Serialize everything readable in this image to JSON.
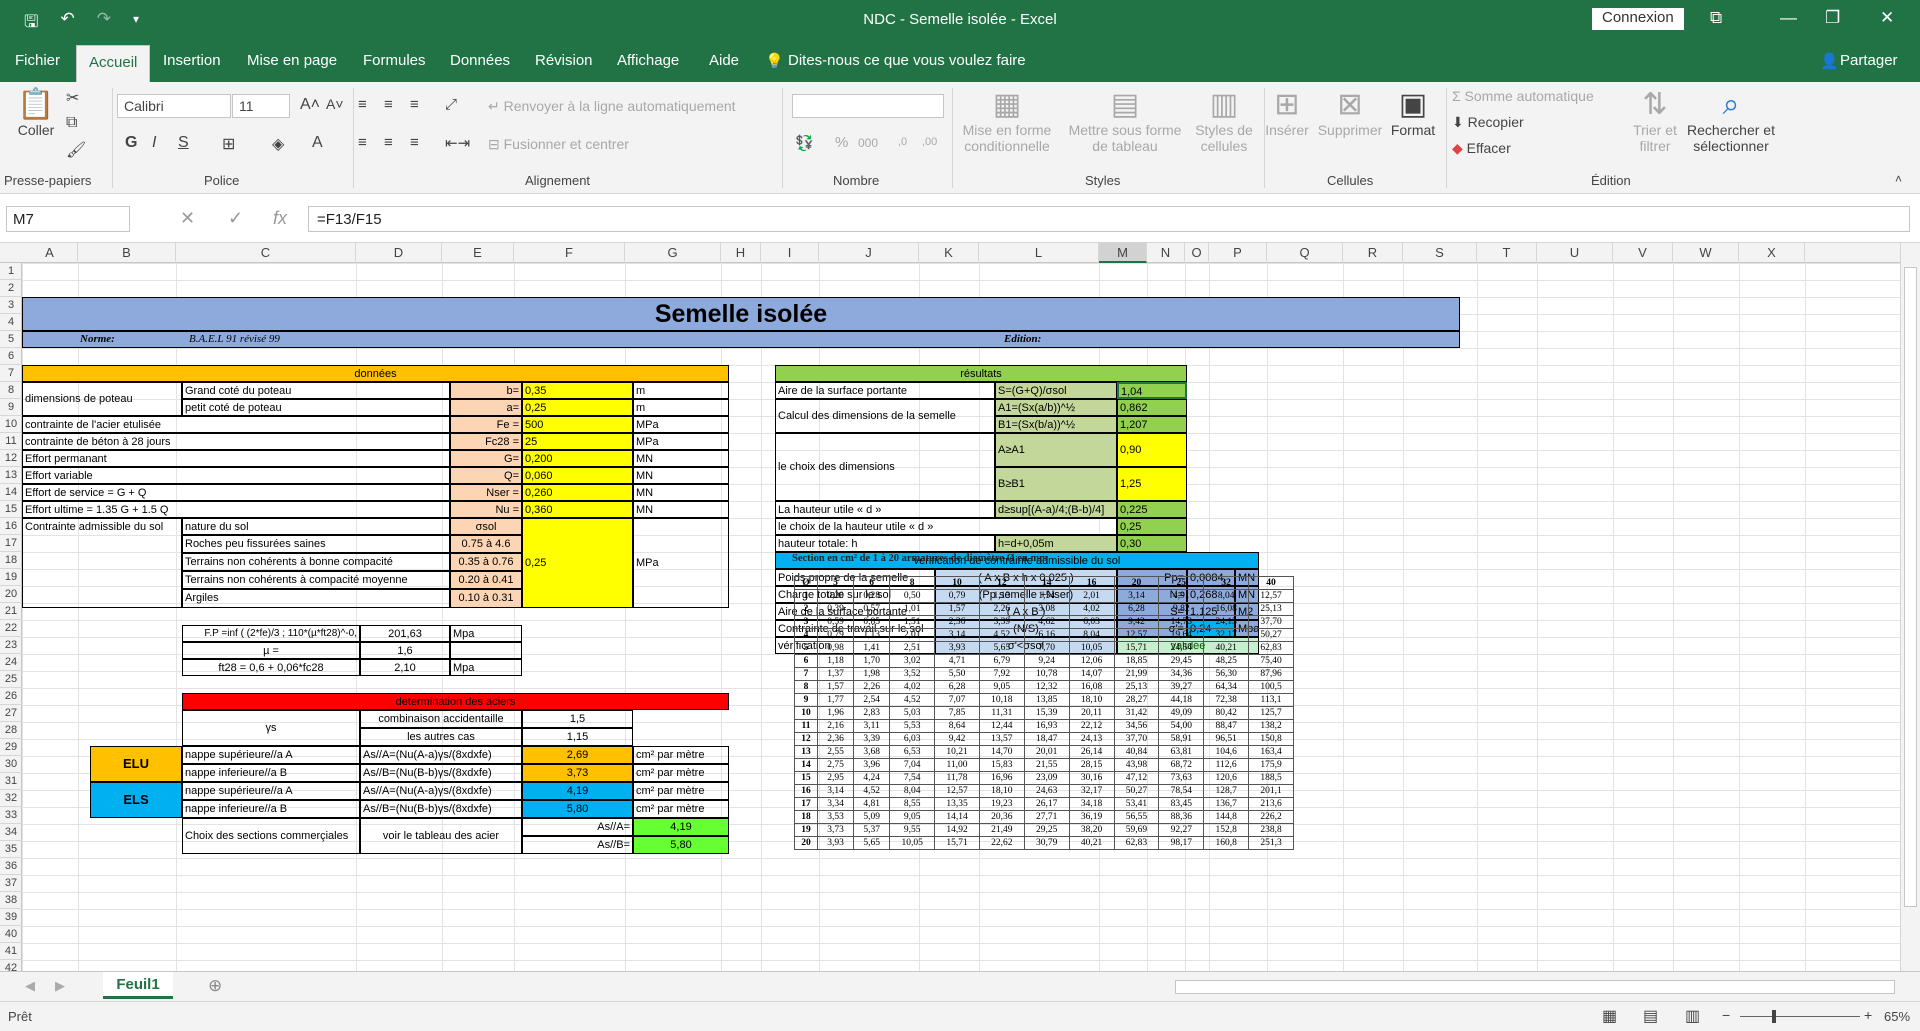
{
  "window": {
    "title": "NDC - Semelle isolée  -  Excel",
    "signin": "Connexion"
  },
  "menu": {
    "tabs": [
      "Fichier",
      "Accueil",
      "Insertion",
      "Mise en page",
      "Formules",
      "Données",
      "Révision",
      "Affichage",
      "Aide"
    ],
    "tell": "Dites-nous ce que vous voulez faire",
    "share": "Partager"
  },
  "ribbon": {
    "coller": "Coller",
    "font_name": "Calibri",
    "font_size": "11",
    "wrap": "Renvoyer à la ligne automatiquement",
    "merge": "Fusionner et centrer",
    "mfc1": "Mise en forme",
    "mfc2": "conditionnelle",
    "mst1": "Mettre sous forme",
    "mst2": "de tableau",
    "sty1": "Styles de",
    "sty2": "cellules",
    "ins": "Insérer",
    "sup": "Supprimer",
    "fmt": "Format",
    "autosum": "Somme automatique",
    "recopier": "Recopier",
    "effacer": "Effacer",
    "trier1": "Trier et",
    "trier2": "filtrer",
    "rech1": "Rechercher et",
    "rech2": "sélectionner",
    "groups": [
      "Presse-papiers",
      "Police",
      "Alignement",
      "Nombre",
      "Styles",
      "Cellules",
      "Édition"
    ]
  },
  "formula_bar": {
    "cell": "M7",
    "formula": "=F13/F15"
  },
  "columns": [
    "A",
    "B",
    "C",
    "D",
    "E",
    "F",
    "G",
    "H",
    "I",
    "J",
    "K",
    "L",
    "M",
    "N",
    "O",
    "P",
    "Q",
    "R",
    "S",
    "T",
    "U",
    "V",
    "W",
    "X"
  ],
  "sheet": {
    "title": "Semelle isolée",
    "norme_label": "Norme:",
    "norme_value": "B.A.E.L 91 révisé 99",
    "edition_label": "Edition:",
    "donnees": "données",
    "r7": [
      "dimensions de poteau",
      "Grand coté du poteau",
      "b=",
      "0,35",
      "m"
    ],
    "r8": [
      "petit coté de poteau",
      "a=",
      "0,25",
      "m"
    ],
    "r9": [
      "contrainte de l'acier etulisée",
      "Fe =",
      "500",
      "MPa"
    ],
    "r10": [
      "contrainte de béton à 28 jours",
      "Fc28 =",
      "25",
      "MPa"
    ],
    "r11": [
      "Effort permanant",
      "G=",
      "0,200",
      "MN"
    ],
    "r12": [
      "Effort variable",
      "Q=",
      "0,060",
      "MN"
    ],
    "r13": [
      "Effort de service =  G + Q",
      "Nser =",
      "0,260",
      "MN"
    ],
    "r14": [
      "Effort ultime =  1.35 G + 1.5 Q",
      "Nu =",
      "0,360",
      "MN"
    ],
    "r15": [
      "Contrainte admissible du sol",
      "nature du sol",
      "σsol"
    ],
    "soils": [
      [
        "Roches peu fissurées saines",
        "0.75 à 4.6"
      ],
      [
        "Terrains non cohérents à bonne compacité",
        "0.35 à 0.76"
      ],
      [
        "Terrains non cohérents à compacité moyenne",
        "0.20 à 0.41"
      ],
      [
        "Argiles",
        "0.10 à 0.31"
      ]
    ],
    "sol_value": "0,25",
    "sol_unit": "MPa",
    "r21": [
      "F.P =inf ( (2*fe)/3 ; 110*(µ*ft28)^-0,",
      "201,63",
      "Mpa"
    ],
    "r22": [
      "µ =",
      "1,6"
    ],
    "r23": [
      "ft28 = 0,6 + 0,06*fc28",
      "2,10",
      "Mpa"
    ],
    "determ": "determination des aciers",
    "gamma": "γs",
    "comb": "combinaison accidentaille",
    "comb_v": "1,5",
    "autres": "les autres cas",
    "autres_v": "1,15",
    "elu": "ELU",
    "els": "ELS",
    "r28": [
      "nappe supérieure//a A",
      "As//A=(Nu(A-a)γs/(8xdxfe)",
      "2,69",
      "cm² par mètre"
    ],
    "r29": [
      "nappe inferieure//a B",
      "As//B=(Nu(B-b)γs/(8xdxfe)",
      "3,73",
      "cm² par mètre"
    ],
    "r30": [
      "nappe supérieure//a A",
      "As//A=(Nu(A-a)γs/(8xdxfe)",
      "4,19",
      "cm² par mètre"
    ],
    "r31": [
      "nappe inferieure//a B",
      "As//B=(Nu(B-b)γs/(8xdxfe)",
      "5,80",
      "cm² par mètre"
    ],
    "choix": "Choix des sections commerçiales",
    "voir": "voir le tableau des acier",
    "asA": "As//A=",
    "asA_v": "4,19",
    "asB": "As//B=",
    "asB_v": "5,80",
    "resultats": "résultats",
    "res7": [
      "Aire de la surface portante",
      "S=(G+Q)/σsol",
      "1,04"
    ],
    "res8": [
      "Calcul des dimensions de la semelle",
      "A1=(Sx(a/b))^½",
      "0,862"
    ],
    "res9": [
      "B1=(Sx(b/a))^½",
      "1,207"
    ],
    "res10": [
      "le choix des dimensions",
      "A≥A1",
      "0,90"
    ],
    "res12": [
      "B≥B1",
      "1,25"
    ],
    "res14": [
      "La hauteur utile « d »",
      "d≥sup[(A-a)/4;(B-b)/4]",
      "0,225"
    ],
    "res15": [
      "le choix de la hauteur utile « d »",
      "0,25"
    ],
    "res16": [
      "hauteur totale: h",
      "h=d+0,05m",
      "0,30"
    ],
    "verif_title": "vérification de contrainte admissible du sol",
    "v18": [
      "Poids propre de la semelle",
      "( A x B x h x 0.025 )",
      "Pp=",
      "0,0084",
      "MN"
    ],
    "v19": [
      "Charge totale sur le sol",
      "(Pp semelle +Nser)",
      "N=",
      "0,268",
      "MN"
    ],
    "v20": [
      "Aire de la surface portante",
      "( A x B )",
      "S=",
      "1,125",
      "M2"
    ],
    "v21": [
      "Contrainte de travail sur le sol",
      "(N/S)",
      "σ'=",
      "0,24",
      "Mpa"
    ],
    "v22": [
      "vérification",
      "σ'<σsol",
      "validée"
    ],
    "steel_title": "Section en cm² de 1 à 20 armatures de diamètre Ø en mm",
    "steel_head": [
      "Ø",
      "5",
      "6",
      "8",
      "10",
      "12",
      "14",
      "16",
      "20",
      "25",
      "32",
      "40"
    ],
    "steel_rows": [
      [
        "1",
        "0,20",
        "0,28",
        "0,50",
        "0,79",
        "1,13",
        "1,54",
        "2,01",
        "3,14",
        "4,91",
        "8,04",
        "12,57"
      ],
      [
        "2",
        "0,39",
        "0,57",
        "1,01",
        "1,57",
        "2,26",
        "3,08",
        "4,02",
        "6,28",
        "9,82",
        "16,08",
        "25,13"
      ],
      [
        "3",
        "0,59",
        "0,85",
        "1,51",
        "2,36",
        "3,39",
        "4,62",
        "6,03",
        "9,42",
        "14,73",
        "24,13",
        "37,70"
      ],
      [
        "4",
        "0,79",
        "1,13",
        "2,01",
        "3,14",
        "4,52",
        "6,16",
        "8,04",
        "12,57",
        "19,64",
        "32,17",
        "50,27"
      ],
      [
        "5",
        "0,98",
        "1,41",
        "2,51",
        "3,93",
        "5,65",
        "7,70",
        "10,05",
        "15,71",
        "24,54",
        "40,21",
        "62,83"
      ],
      [
        "6",
        "1,18",
        "1,70",
        "3,02",
        "4,71",
        "6,79",
        "9,24",
        "12,06",
        "18,85",
        "29,45",
        "48,25",
        "75,40"
      ],
      [
        "7",
        "1,37",
        "1,98",
        "3,52",
        "5,50",
        "7,92",
        "10,78",
        "14,07",
        "21,99",
        "34,36",
        "56,30",
        "87,96"
      ],
      [
        "8",
        "1,57",
        "2,26",
        "4,02",
        "6,28",
        "9,05",
        "12,32",
        "16,08",
        "25,13",
        "39,27",
        "64,34",
        "100,5"
      ],
      [
        "9",
        "1,77",
        "2,54",
        "4,52",
        "7,07",
        "10,18",
        "13,85",
        "18,10",
        "28,27",
        "44,18",
        "72,38",
        "113,1"
      ],
      [
        "10",
        "1,96",
        "2,83",
        "5,03",
        "7,85",
        "11,31",
        "15,39",
        "20,11",
        "31,42",
        "49,09",
        "80,42",
        "125,7"
      ],
      [
        "11",
        "2,16",
        "3,11",
        "5,53",
        "8,64",
        "12,44",
        "16,93",
        "22,12",
        "34,56",
        "54,00",
        "88,47",
        "138,2"
      ],
      [
        "12",
        "2,36",
        "3,39",
        "6,03",
        "9,42",
        "13,57",
        "18,47",
        "24,13",
        "37,70",
        "58,91",
        "96,51",
        "150,8"
      ],
      [
        "13",
        "2,55",
        "3,68",
        "6,53",
        "10,21",
        "14,70",
        "20,01",
        "26,14",
        "40,84",
        "63,81",
        "104,6",
        "163,4"
      ],
      [
        "14",
        "2,75",
        "3,96",
        "7,04",
        "11,00",
        "15,83",
        "21,55",
        "28,15",
        "43,98",
        "68,72",
        "112,6",
        "175,9"
      ],
      [
        "15",
        "2,95",
        "4,24",
        "7,54",
        "11,78",
        "16,96",
        "23,09",
        "30,16",
        "47,12",
        "73,63",
        "120,6",
        "188,5"
      ],
      [
        "16",
        "3,14",
        "4,52",
        "8,04",
        "12,57",
        "18,10",
        "24,63",
        "32,17",
        "50,27",
        "78,54",
        "128,7",
        "201,1"
      ],
      [
        "17",
        "3,34",
        "4,81",
        "8,55",
        "13,35",
        "19,23",
        "26,17",
        "34,18",
        "53,41",
        "83,45",
        "136,7",
        "213,6"
      ],
      [
        "18",
        "3,53",
        "5,09",
        "9,05",
        "14,14",
        "20,36",
        "27,71",
        "36,19",
        "56,55",
        "88,36",
        "144,8",
        "226,2"
      ],
      [
        "19",
        "3,73",
        "5,37",
        "9,55",
        "14,92",
        "21,49",
        "29,25",
        "38,20",
        "59,69",
        "92,27",
        "152,8",
        "238,8"
      ],
      [
        "20",
        "3,93",
        "5,65",
        "10,05",
        "15,71",
        "22,62",
        "30,79",
        "40,21",
        "62,83",
        "98,17",
        "160,8",
        "251,3"
      ]
    ]
  },
  "sheet_tab": "Feuil1",
  "status": {
    "ready": "Prêt",
    "zoom": "65%"
  }
}
